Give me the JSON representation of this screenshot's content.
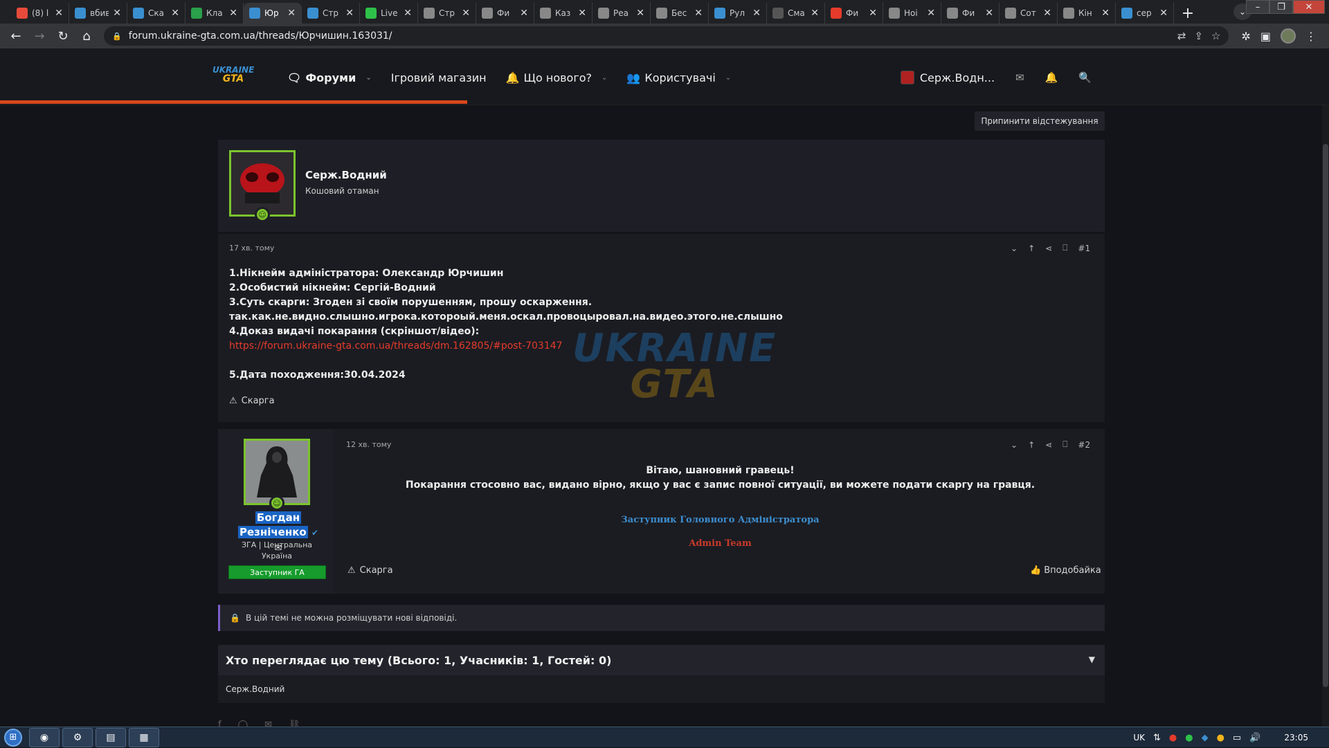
{
  "browser": {
    "tabs": [
      {
        "label": "(8) l",
        "color": "#e64a3b"
      },
      {
        "label": "вбив",
        "color": "#3a8fd0"
      },
      {
        "label": "Ска",
        "color": "#3a8fd0"
      },
      {
        "label": "Кла",
        "color": "#2aa04a"
      },
      {
        "label": "Юр",
        "color": "#3a8fd0",
        "active": true
      },
      {
        "label": "Стр",
        "color": "#3a8fd0"
      },
      {
        "label": "Live",
        "color": "#2ec14a"
      },
      {
        "label": "Стр",
        "color": "#888888"
      },
      {
        "label": "Фи",
        "color": "#888888"
      },
      {
        "label": "Каз",
        "color": "#888888"
      },
      {
        "label": "Реа",
        "color": "#888888"
      },
      {
        "label": "Бес",
        "color": "#888888"
      },
      {
        "label": "Рул",
        "color": "#3a8fd0"
      },
      {
        "label": "Сма",
        "color": "#555555"
      },
      {
        "label": "Фи",
        "color": "#e53b2b"
      },
      {
        "label": "Ноі",
        "color": "#888888"
      },
      {
        "label": "Фи",
        "color": "#888888"
      },
      {
        "label": "Сот",
        "color": "#888888"
      },
      {
        "label": "Кін",
        "color": "#888888"
      },
      {
        "label": "сер",
        "color": "#3a8fd0"
      }
    ],
    "url": "forum.ukraine-gta.com.ua/threads/Юрчишин.163031/"
  },
  "header": {
    "logo_line1": "UKRAINE",
    "logo_line2": "GTA",
    "nav": {
      "forums": "Форуми",
      "shop": "Ігровий магазин",
      "whats_new": "Що нового?",
      "users": "Користувачі"
    },
    "user_name": "Серж.Водн..."
  },
  "thread": {
    "follow_button": "Припинити відстежування",
    "post1": {
      "author": "Серж.Водний",
      "author_title": "Кошовий отаман",
      "time": "17 хв. тому",
      "number": "#1",
      "lines": [
        "1.Нікнейм адміністратора: Олександр Юрчишин",
        "2.Особистий нікнейм: Сергій-Водний",
        "3.Суть скарги: Згоден зі своїм порушенням, прошу оскарження.",
        "так.как.не.видно.слышно.игрока.котороый.меня.оскал.провоцыровал.на.видео.этого.не.слышно",
        "4.Доказ видачі покарання (скріншот/відео):"
      ],
      "link": "https://forum.ukraine-gta.com.ua/threads/dm.162805/#post-703147",
      "date_line": "5.Дата походження:30.04.2024",
      "report": "Скарга",
      "watermark_line1": "UKRAINE",
      "watermark_line2": "GTA"
    },
    "post2": {
      "author_first": "Богдан",
      "author_last": "Резніченко",
      "author_info": "ЗГА | Центральна Україна",
      "rank": "Заступник ГА",
      "time": "12 хв. тому",
      "number": "#2",
      "greeting": "Вітаю, шановний гравець!",
      "body": "Покарання стосовно вас, видано вірно, якщо у вас є запис повної ситуації, ви можете подати скаргу на гравця.",
      "signature1": "Заступник Головного Адміністратора",
      "signature2": "Admin Team",
      "report": "Скарга",
      "like": "Вподобайка"
    },
    "locked_notice": "В цій темі не можна розміщувати нові відповіді.",
    "viewers_header": "Хто переглядає цю тему (Всього: 1, Учасників: 1, Гостей: 0)",
    "viewers": "Серж.Водний"
  },
  "taskbar": {
    "lang": "UK",
    "time": "23:05"
  }
}
